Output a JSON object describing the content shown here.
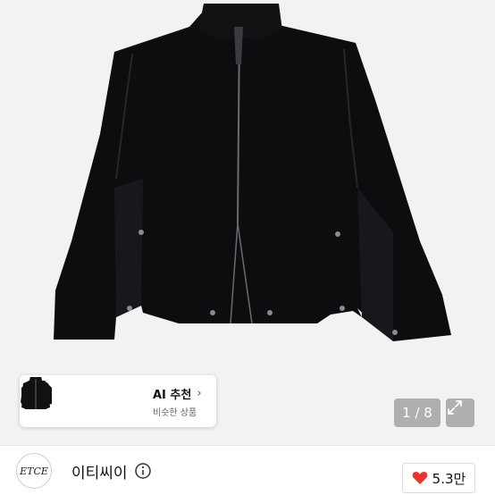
{
  "product": {
    "image_icon": "jacket-image"
  },
  "ai_recommend": {
    "title": "AI 추천",
    "subtitle": "비슷한 상품",
    "chevron_icon": "chevron-right-icon",
    "thumbnails": [
      "jacket-thumbnail-1",
      "jacket-thumbnail-2",
      "jacket-thumbnail-3"
    ]
  },
  "gallery": {
    "counter": "1 / 8",
    "expand_icon": "expand-icon"
  },
  "seller": {
    "logo_text": "ETCE",
    "name": "이티씨이",
    "info_icon": "info-icon"
  },
  "likes": {
    "count": "5.3만",
    "heart_icon": "heart-icon",
    "color": "#e8352e"
  }
}
